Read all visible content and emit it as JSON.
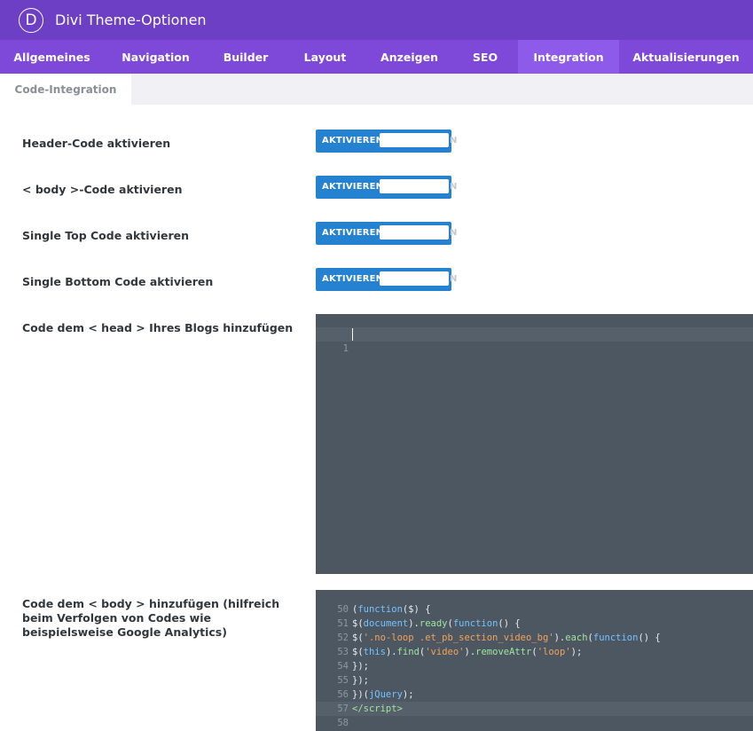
{
  "header": {
    "logo_letter": "D",
    "title": "Divi Theme-Optionen"
  },
  "nav": {
    "tabs": [
      {
        "label": "Allgemeines"
      },
      {
        "label": "Navigation"
      },
      {
        "label": "Builder"
      },
      {
        "label": "Layout"
      },
      {
        "label": "Anzeigen"
      },
      {
        "label": "SEO"
      },
      {
        "label": "Integration",
        "active": true
      },
      {
        "label": "Aktualisierungen"
      }
    ]
  },
  "subnav": {
    "tab": "Code-Integration"
  },
  "settings": {
    "toggle_on_label": "AKTIVIEREN",
    "toggle_off_label": "N",
    "rows": [
      {
        "label": "Header-Code aktivieren"
      },
      {
        "label": "< body >-Code aktivieren"
      },
      {
        "label": "Single Top Code aktivieren"
      },
      {
        "label": "Single Bottom Code aktivieren"
      }
    ],
    "head_code_label": "Code dem < head > Ihres Blogs hinzufügen",
    "body_code_label": "Code dem < body > hinzufügen (hilfreich beim Verfolgen von Codes wie beispielsweise Google Analytics)"
  },
  "head_editor": {
    "line_number": "1"
  },
  "body_editor": {
    "line_numbers": [
      "50",
      "51",
      "52",
      "53",
      "54",
      "55",
      "56",
      "57",
      "58"
    ]
  },
  "colors": {
    "topbar": "#6c3fc4",
    "navbar": "#7e48d8",
    "nav_active": "#8e5ae9",
    "toggle": "#2582d0",
    "editor_bg": "#4d5761"
  }
}
